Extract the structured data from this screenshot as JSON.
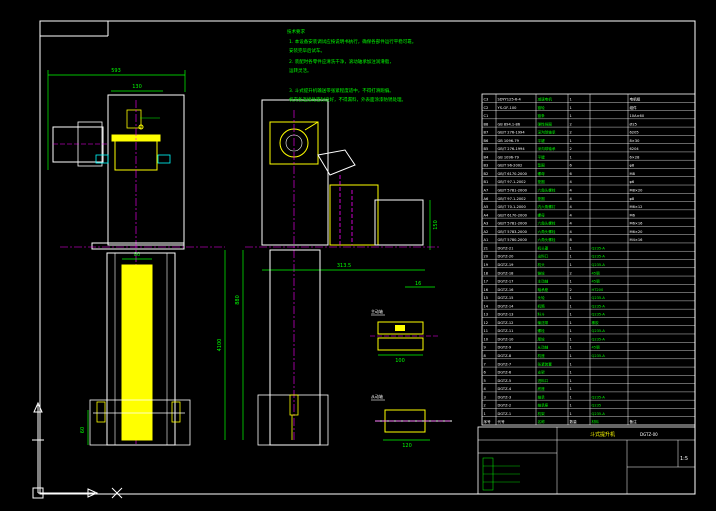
{
  "dimensions": {
    "width_top": "593",
    "chute_width": "130",
    "belt_width": "80",
    "total_height": "880",
    "long_height": "4100",
    "foot_height": "60",
    "side_depth": "313.5",
    "hopper_height": "150",
    "roller_top_dim": "16",
    "roller_top_len": "100",
    "roller_bot_len": "120"
  },
  "notes": {
    "title": "技术要求",
    "lines": [
      "1. 本设备安装调试应按说明书执行，确保各部件运行平稳可靠。",
      "安装完毕后试车。",
      "2. 装配时各零件应清洗干净，滚动轴承加注润滑脂，",
      "运转灵活。",
      "3. 斗式提升机输送带张紧程度适中，不得打滑跑偏。",
      "机壳各连接处密封良好，不得漏料，外表面涂漆防锈处理。"
    ]
  },
  "bom": {
    "rows": [
      {
        "no": "C3",
        "code": "SDYY125-6-4",
        "name": "减速电机",
        "qty": "1",
        "mat": "",
        "note": "电机组"
      },
      {
        "no": "C2",
        "code": "YS-GF-100",
        "name": "链轮",
        "qty": "1",
        "mat": "",
        "note": "组件"
      },
      {
        "no": "C1",
        "code": "",
        "name": "链条",
        "qty": "1",
        "mat": "",
        "note": "10A×60"
      },
      {
        "no": "B8",
        "code": "GB 894.1-86",
        "name": "弹性挡圈",
        "qty": "2",
        "mat": "",
        "note": "Ø25"
      },
      {
        "no": "B7",
        "code": "GB/T 276-1994",
        "name": "深沟球轴承",
        "qty": "2",
        "mat": "",
        "note": "6205"
      },
      {
        "no": "B6",
        "code": "GB 1096-79",
        "name": "平键",
        "qty": "1",
        "mat": "",
        "note": "8×30"
      },
      {
        "no": "B5",
        "code": "GB/T 276-1994",
        "name": "深沟球轴承",
        "qty": "2",
        "mat": "",
        "note": "6204"
      },
      {
        "no": "B4",
        "code": "GB 1096-79",
        "name": "平键",
        "qty": "1",
        "mat": "",
        "note": "6×28"
      },
      {
        "no": "B3",
        "code": "GB/T 96-2002",
        "name": "垫圈",
        "qty": "6",
        "mat": "",
        "note": "φ8"
      },
      {
        "no": "B2",
        "code": "GB/T 6170-2000",
        "name": "螺母",
        "qty": "6",
        "mat": "",
        "note": "M8"
      },
      {
        "no": "B1",
        "code": "GB/T 97.1-2002",
        "name": "垫圈",
        "qty": "4",
        "mat": "",
        "note": "φ6"
      },
      {
        "no": "A7",
        "code": "GB/T 5781-2000",
        "name": "六角头螺栓",
        "qty": "4",
        "mat": "",
        "note": "M8×20"
      },
      {
        "no": "A6",
        "code": "GB/T 97.1-2002",
        "name": "垫圈",
        "qty": "4",
        "mat": "",
        "note": "φ8"
      },
      {
        "no": "A5",
        "code": "GB/T 70.1-2000",
        "name": "内六角螺钉",
        "qty": "4",
        "mat": "",
        "note": "M6×12"
      },
      {
        "no": "A4",
        "code": "GB/T 6170-2000",
        "name": "螺母",
        "qty": "4",
        "mat": "",
        "note": "M6"
      },
      {
        "no": "A3",
        "code": "GB/T 5781-2000",
        "name": "六角头螺栓",
        "qty": "4",
        "mat": "",
        "note": "M6×16"
      },
      {
        "no": "A2",
        "code": "GB/T 5783-2000",
        "name": "六角头螺栓",
        "qty": "4",
        "mat": "",
        "note": "M6×20"
      },
      {
        "no": "A1",
        "code": "GB/T 5780-2000",
        "name": "六角头螺栓",
        "qty": "8",
        "mat": "",
        "note": "M4×16"
      },
      {
        "no": "21",
        "code": "DGTZ-21",
        "name": "机头罩",
        "qty": "1",
        "mat": "Q235-A",
        "note": ""
      },
      {
        "no": "20",
        "code": "DGTZ-20",
        "name": "出料口",
        "qty": "1",
        "mat": "Q235-A",
        "note": ""
      },
      {
        "no": "19",
        "code": "DGTZ-19",
        "name": "机头",
        "qty": "1",
        "mat": "Q235-A",
        "note": ""
      },
      {
        "no": "18",
        "code": "DGTZ-18",
        "name": "链轮",
        "qty": "2",
        "mat": "45钢",
        "note": ""
      },
      {
        "no": "17",
        "code": "DGTZ-17",
        "name": "主动轴",
        "qty": "1",
        "mat": "45钢",
        "note": ""
      },
      {
        "no": "16",
        "code": "DGTZ-16",
        "name": "轴承座",
        "qty": "2",
        "mat": "HT200",
        "note": ""
      },
      {
        "no": "15",
        "code": "DGTZ-15",
        "name": "头轮",
        "qty": "1",
        "mat": "Q235-A",
        "note": ""
      },
      {
        "no": "14",
        "code": "DGTZ-14",
        "name": "机筒",
        "qty": "1",
        "mat": "Q235-A",
        "note": ""
      },
      {
        "no": "13",
        "code": "DGTZ-13",
        "name": "料斗",
        "qty": "1",
        "mat": "Q235-A",
        "note": ""
      },
      {
        "no": "12",
        "code": "DGTZ-12",
        "name": "输送带",
        "qty": "1",
        "mat": "橡胶",
        "note": ""
      },
      {
        "no": "11",
        "code": "DGTZ-11",
        "name": "螺栓",
        "qty": "1",
        "mat": "Q235-A",
        "note": ""
      },
      {
        "no": "10",
        "code": "DGTZ-10",
        "name": "尾轮",
        "qty": "1",
        "mat": "Q235-A",
        "note": ""
      },
      {
        "no": "9",
        "code": "DGTZ-9",
        "name": "从动轴",
        "qty": "1",
        "mat": "45钢",
        "note": ""
      },
      {
        "no": "8",
        "code": "DGTZ-8",
        "name": "机座",
        "qty": "1",
        "mat": "Q235-A",
        "note": ""
      },
      {
        "no": "7",
        "code": "DGTZ-7",
        "name": "张紧装置",
        "qty": "1",
        "mat": "",
        "note": ""
      },
      {
        "no": "6",
        "code": "DGTZ-6",
        "name": "支架",
        "qty": "1",
        "mat": "",
        "note": ""
      },
      {
        "no": "5",
        "code": "DGTZ-5",
        "name": "进料口",
        "qty": "1",
        "mat": "",
        "note": ""
      },
      {
        "no": "4",
        "code": "DGTZ-4",
        "name": "底座",
        "qty": "1",
        "mat": "",
        "note": ""
      },
      {
        "no": "3",
        "code": "DGTZ-3",
        "name": "轴承",
        "qty": "1",
        "mat": "Q235-A",
        "note": ""
      },
      {
        "no": "2",
        "code": "DGTZ-2",
        "name": "轴承座",
        "qty": "1",
        "mat": "Q235",
        "note": ""
      },
      {
        "no": "1",
        "code": "DGTZ-1",
        "name": "机架",
        "qty": "1",
        "mat": "Q235-A",
        "note": ""
      }
    ],
    "header": {
      "no": "序号",
      "code": "代号",
      "name": "名称",
      "qty": "数量",
      "mat": "材料",
      "note": "备注"
    }
  },
  "title_block": {
    "drawing_title": "斗式提升机",
    "scale": "1:5",
    "code": "DGTZ-00"
  },
  "colors": {
    "background": "#000000",
    "outline": "#ffffff",
    "dimension": "#00ff00",
    "centerline": "#ff00ff",
    "parts": "#ffff00",
    "hidden": "#00ffff"
  }
}
